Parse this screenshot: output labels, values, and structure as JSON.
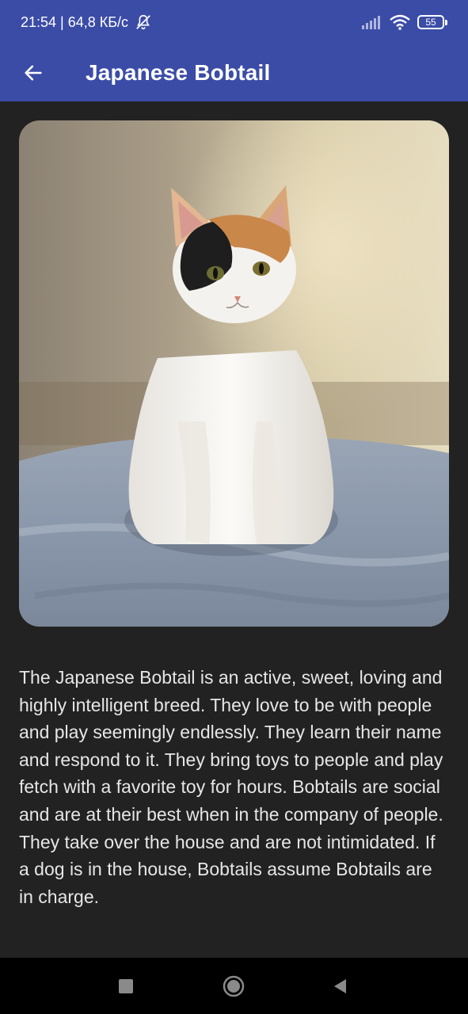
{
  "status_bar": {
    "time_speed": "21:54 | 64,8 КБ/с",
    "icons": [
      "bell-off-icon",
      "signal-icon",
      "wifi-icon",
      "battery-icon"
    ],
    "battery_level": "55"
  },
  "app_bar": {
    "title": "Japanese Bobtail",
    "back_icon": "arrow-back-icon"
  },
  "breed": {
    "image": "cat-photo",
    "description": "The Japanese Bobtail is an active, sweet, loving and highly intelligent breed. They love to be with people and play seemingly endlessly. They learn their name and respond to it. They bring toys to people and play fetch with a favorite toy for hours. Bobtails are social and are at their best when in the company of people. They take over the house and are not intimidated. If a dog is in the house, Bobtails assume Bobtails are in charge."
  },
  "nav_bar": {
    "buttons": [
      "recents-icon",
      "home-icon",
      "back-icon"
    ]
  },
  "colors": {
    "app_bar": "#3b4ca7",
    "background": "#222222",
    "text": "#e6e6e6"
  }
}
